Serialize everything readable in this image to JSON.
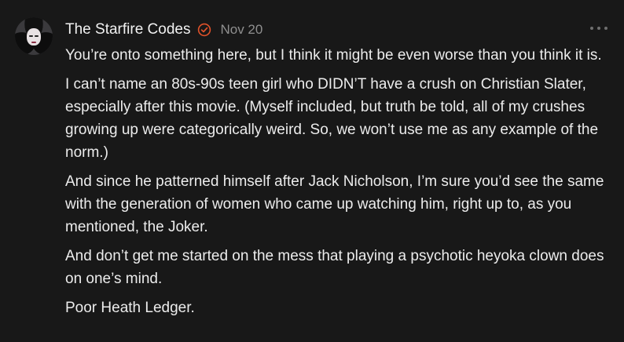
{
  "comment": {
    "author": "The Starfire Codes",
    "date": "Nov 20",
    "icons": {
      "verified": "verified-badge-icon",
      "more": "more-options-icon"
    },
    "accent_color": "#e0522a",
    "paragraphs": [
      "You’re onto something here, but I think it might be even worse than you think it is.",
      "I can’t name an 80s-90s teen girl who DIDN’T have a crush on Christian Slater, especially after this movie. (Myself included, but truth be told, all of my crushes growing up were categorically weird. So, we won’t use me as any example of the norm.)",
      "And since he patterned himself after Jack Nicholson, I’m sure you’d see the same with the generation of women who came up watching him, right up to, as you mentioned, the Joker.",
      "And don’t get me started on the mess that playing a psychotic heyoka clown does on one’s mind.",
      "Poor Heath Ledger."
    ]
  }
}
